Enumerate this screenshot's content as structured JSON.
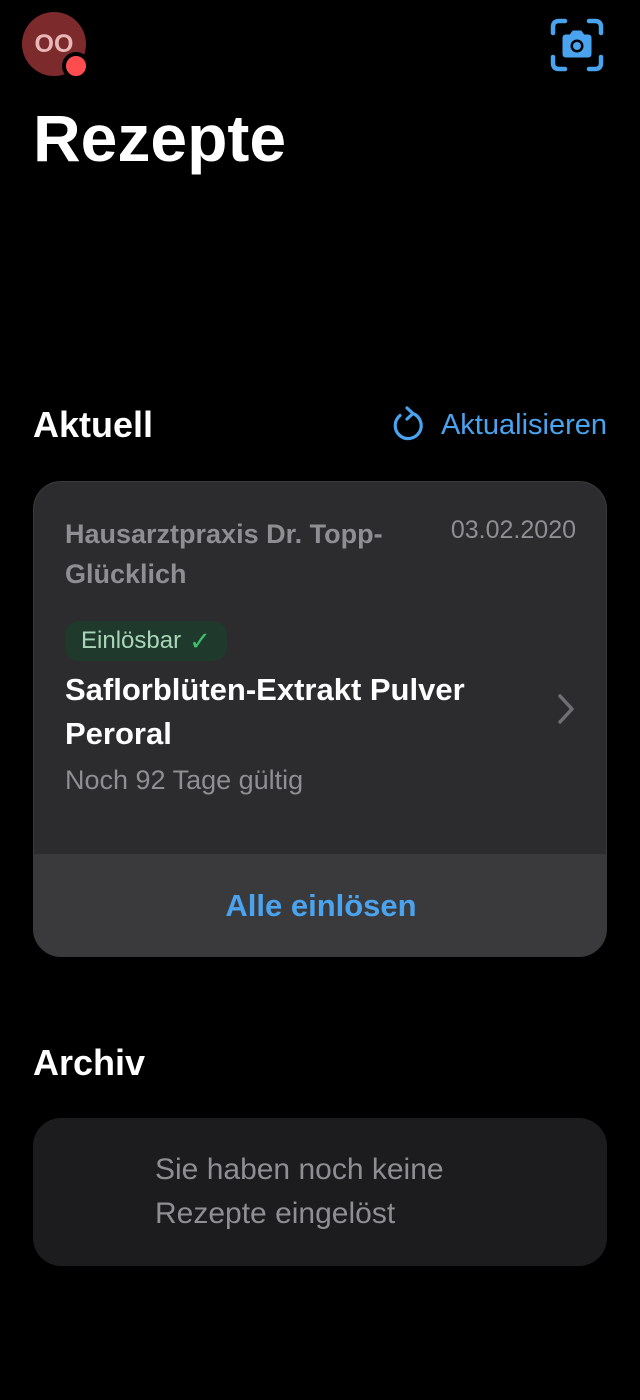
{
  "header": {
    "avatar_initials": "OO",
    "title": "Rezepte"
  },
  "icons": {
    "scan": "camera-scan-icon",
    "refresh": "refresh-icon",
    "chevron": "chevron-right-icon",
    "badge_check": "checkmark-icon"
  },
  "colors": {
    "accent": "#4aa3ee",
    "avatar_bg": "#7d2a2c",
    "notification_dot": "#ff4d4f",
    "badge_bg": "#1f3a2c",
    "badge_check": "#3fbf6c",
    "card_bg": "#2c2c2e"
  },
  "current": {
    "title": "Aktuell",
    "refresh_label": "Aktualisieren",
    "prescription": {
      "practice": "Hausarztpraxis Dr. Topp-Glücklich",
      "date": "03.02.2020",
      "status": "Einlösbar",
      "status_mark": "✓",
      "medication": "Saflorblüten-Extrakt Pulver Peroral",
      "validity": "Noch 92 Tage gültig"
    },
    "redeem_all_label": "Alle einlösen"
  },
  "archive": {
    "title": "Archiv",
    "empty_message": "Sie haben noch keine Rezepte eingelöst"
  }
}
